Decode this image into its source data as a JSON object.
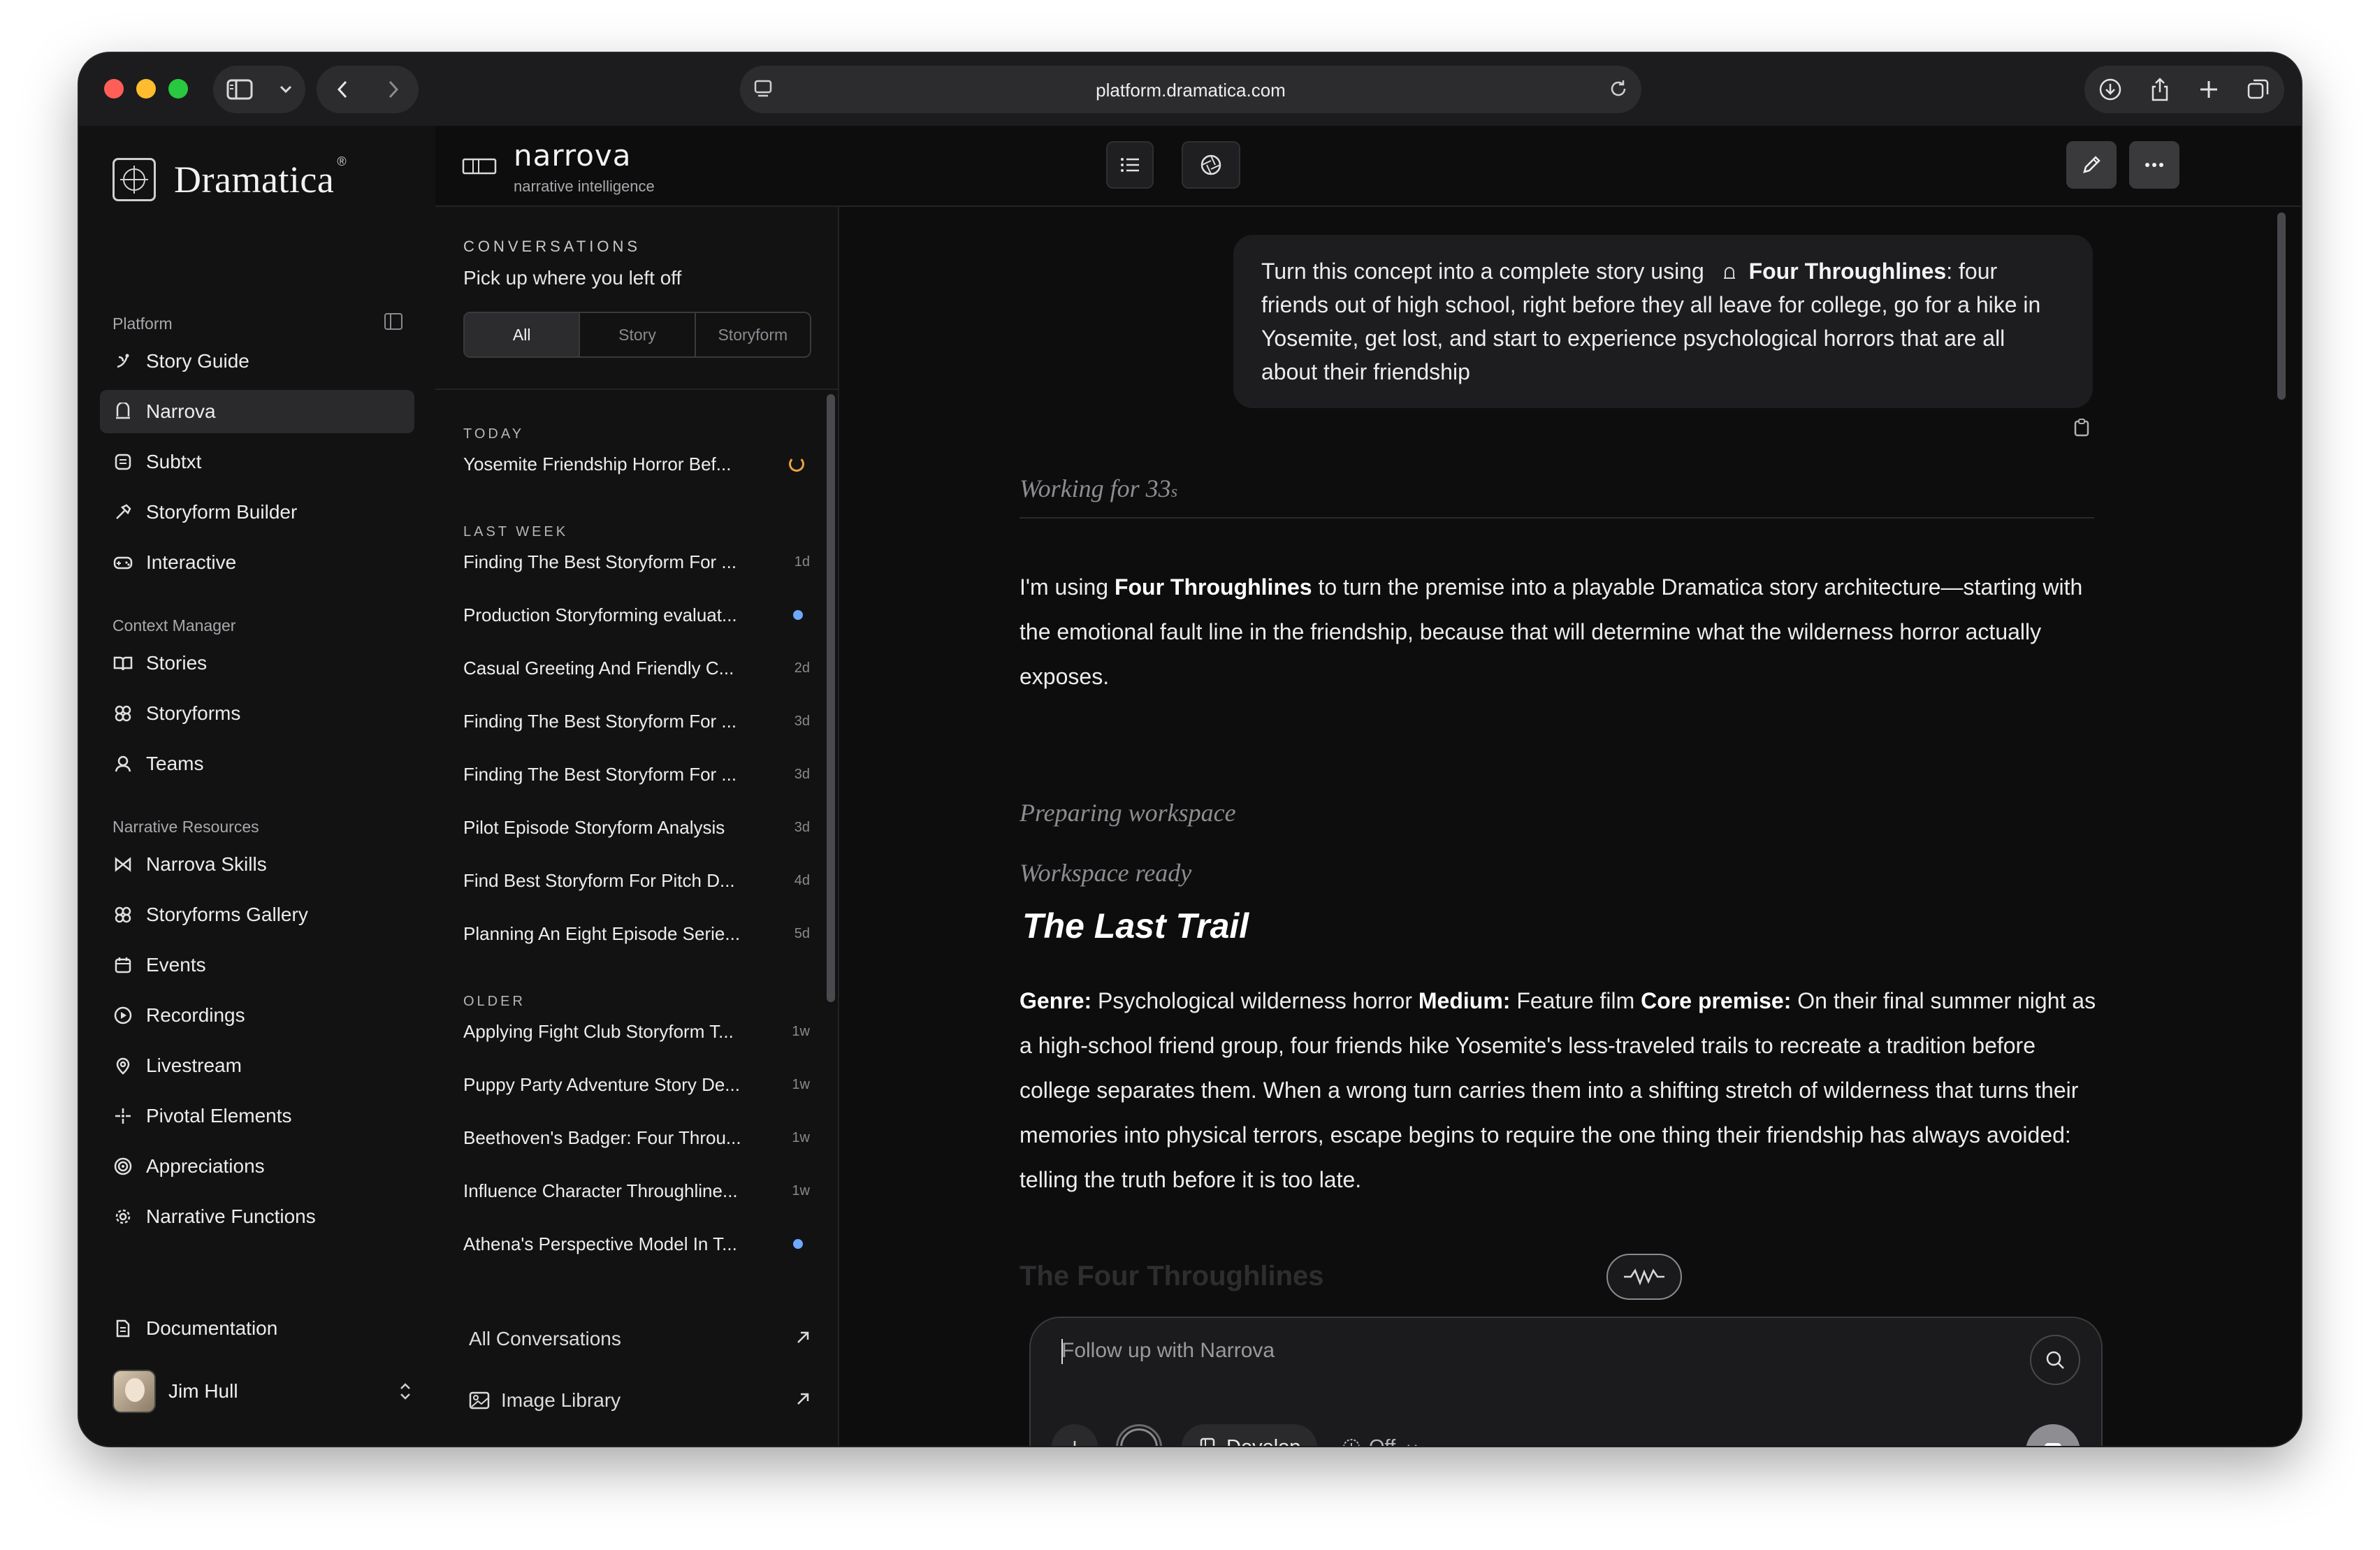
{
  "browser": {
    "url": "platform.dramatica.com"
  },
  "sidebar": {
    "brand": "Dramatica",
    "brand_mark": "®",
    "sections": [
      {
        "label": "Platform"
      },
      {
        "label": "Context Manager"
      },
      {
        "label": "Narrative Resources"
      }
    ],
    "platform_items": [
      {
        "label": "Story Guide",
        "icon": "story-guide-icon"
      },
      {
        "label": "Narrova",
        "icon": "narrova-icon",
        "active": true
      },
      {
        "label": "Subtxt",
        "icon": "subtxt-icon"
      },
      {
        "label": "Storyform Builder",
        "icon": "hammer-icon"
      },
      {
        "label": "Interactive",
        "icon": "gamepad-icon"
      }
    ],
    "context_items": [
      {
        "label": "Stories",
        "icon": "book-icon"
      },
      {
        "label": "Storyforms",
        "icon": "storyform-icon"
      },
      {
        "label": "Teams",
        "icon": "user-icon"
      }
    ],
    "resource_items": [
      {
        "label": "Narrova Skills",
        "icon": "skills-icon"
      },
      {
        "label": "Storyforms Gallery",
        "icon": "gallery-icon"
      },
      {
        "label": "Events",
        "icon": "calendar-icon"
      },
      {
        "label": "Recordings",
        "icon": "play-icon"
      },
      {
        "label": "Livestream",
        "icon": "pin-icon"
      },
      {
        "label": "Pivotal Elements",
        "icon": "sparkle-icon"
      },
      {
        "label": "Appreciations",
        "icon": "target-icon"
      },
      {
        "label": "Narrative Functions",
        "icon": "cog-icon"
      }
    ],
    "documentation": "Documentation",
    "user": {
      "name": "Jim Hull"
    }
  },
  "header": {
    "title": "narrova",
    "subtitle": "narrative intelligence"
  },
  "conversations": {
    "title": "CONVERSATIONS",
    "subtitle": "Pick up where you left off",
    "tabs": [
      "All",
      "Story",
      "Storyform"
    ],
    "groups": {
      "today": "TODAY",
      "last_week": "LAST WEEK",
      "older": "OLDER"
    },
    "today": [
      {
        "title": "Yosemite Friendship Horror Bef...",
        "meta": ""
      }
    ],
    "last_week": [
      {
        "title": "Finding The Best Storyform For ...",
        "meta": "1d"
      },
      {
        "title": "Production Storyforming evaluat...",
        "meta": ""
      },
      {
        "title": "Casual Greeting And Friendly C...",
        "meta": "2d"
      },
      {
        "title": "Finding The Best Storyform For ...",
        "meta": "3d"
      },
      {
        "title": "Finding The Best Storyform For ...",
        "meta": "3d"
      },
      {
        "title": "Pilot Episode Storyform Analysis",
        "meta": "3d"
      },
      {
        "title": "Find Best Storyform For Pitch D...",
        "meta": "4d"
      },
      {
        "title": "Planning An Eight Episode Serie...",
        "meta": "5d"
      }
    ],
    "older": [
      {
        "title": "Applying Fight Club Storyform T...",
        "meta": "1w"
      },
      {
        "title": "Puppy Party Adventure Story De...",
        "meta": "1w"
      },
      {
        "title": "Beethoven's Badger: Four Throu...",
        "meta": "1w"
      },
      {
        "title": "Influence Character Throughline...",
        "meta": "1w"
      },
      {
        "title": "Athena's Perspective Model In T...",
        "meta": ""
      }
    ],
    "all_link": "All Conversations",
    "image_link": "Image Library"
  },
  "chat": {
    "user_message_before": "Turn this concept into a complete story using",
    "user_message_ref": "Four Throughlines",
    "user_message_after": ": four friends out of high school, right before they all leave for college, go for a hike in Yosemite, get lost, and start to experience psychological horrors that are all about their friendship",
    "working_label": "Working for 33",
    "working_unit": "s",
    "intro_a": "I'm using ",
    "intro_bold": "Four Throughlines",
    "intro_b": " to turn the premise into a playable Dramatica story architecture—starting with the emotional fault line in the friendship, because that will determine what the wilderness horror actually exposes.",
    "status_1": "Preparing workspace",
    "status_2": "Workspace ready",
    "story_title": "The Last Trail",
    "genre_label": "Genre:",
    "genre": " Psychological wilderness horror ",
    "medium_label": "Medium:",
    "medium": " Feature film ",
    "premise_label": "Core premise:",
    "premise": " On their final summer night as a high-school friend group, four friends hike Yosemite's less-traveled trails to recreate a tradition before college separates them. When a wrong turn carries them into a shifting stretch of wilderness that turns their memories into physical terrors, escape begins to require the one thing their friendship has always avoided: telling the truth before it is too late.",
    "next_heading": "The Four Throughlines"
  },
  "composer": {
    "placeholder": "Follow up with Narrova",
    "develop_label": "Develop",
    "off_label": "Off"
  }
}
